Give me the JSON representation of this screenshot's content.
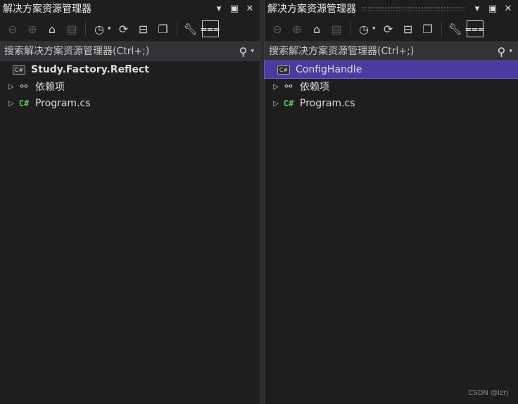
{
  "left": {
    "title": "解决方案资源管理器",
    "search_placeholder": "搜索解决方案资源管理器(Ctrl+;)",
    "project_name": "Study.Factory.Reflect",
    "deps_label": "依赖项",
    "file_label": "Program.cs"
  },
  "right": {
    "title": "解决方案资源管理器",
    "search_placeholder": "搜索解决方案资源管理器(Ctrl+;)",
    "project_name": "ConfigHandle",
    "deps_label": "依赖项",
    "file_label": "Program.cs"
  },
  "icons": {
    "cs_project": "C#",
    "cs_file": "C#"
  },
  "watermark": "CSDN @lzrj",
  "colors": {
    "background": "#1e1e1e",
    "search_bg": "#333337",
    "selection": "#4a3b9e",
    "csharp_green": "#57c26a"
  }
}
